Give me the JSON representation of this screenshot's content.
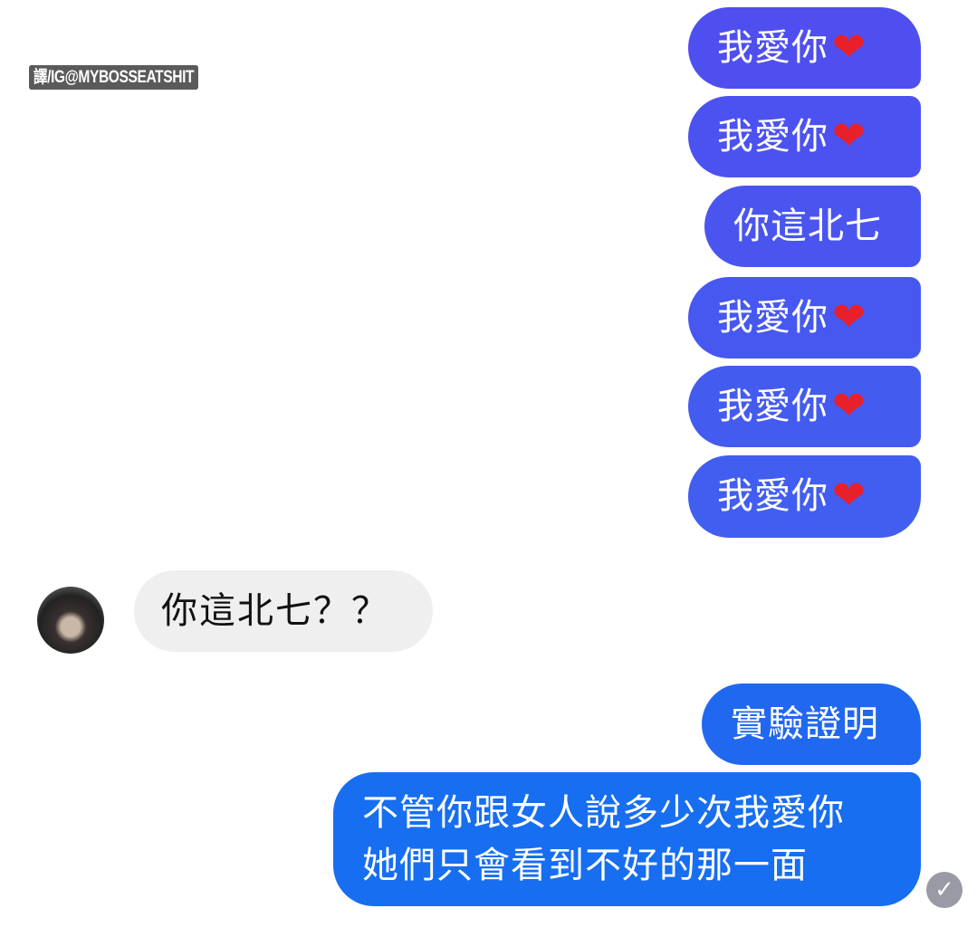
{
  "watermark": "譯/IG@MYBOSSEATSHIT",
  "sent_group_1": [
    {
      "text": "我愛你",
      "emoji": "❤",
      "color": "#4f4ff0"
    },
    {
      "text": "我愛你",
      "emoji": "❤",
      "color": "#4c52f0"
    },
    {
      "text": "你這北七",
      "emoji": "",
      "color": "#4a55f0"
    },
    {
      "text": "我愛你",
      "emoji": "❤",
      "color": "#4758f0"
    },
    {
      "text": "我愛你",
      "emoji": "❤",
      "color": "#445bf0"
    },
    {
      "text": "我愛你",
      "emoji": "❤",
      "color": "#415ef0"
    }
  ],
  "received": {
    "text": "你這北七？？",
    "avatar": "avatar-photo"
  },
  "sent_group_2": [
    {
      "text": "實驗證明",
      "color": "#2068f0"
    },
    {
      "text": "不管你跟女人說多少次我愛你",
      "text2": "她們只會看到不好的那一面",
      "color": "#176ef0"
    }
  ],
  "status": {
    "icon": "check-circle-icon",
    "state": "seen"
  }
}
